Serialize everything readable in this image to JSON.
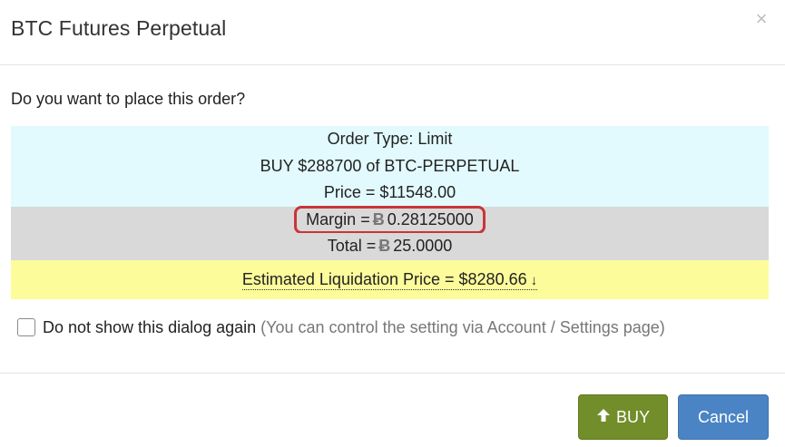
{
  "dialog": {
    "title": "BTC Futures Perpetual",
    "close_glyph": "×",
    "question": "Do you want to place this order?"
  },
  "summary": {
    "order_type": "Order Type: Limit",
    "order_desc": "BUY $288700 of BTC-PERPETUAL",
    "price": "Price = $11548.00",
    "margin_label": "Margin =",
    "margin_value": "0.28125000",
    "total_label": "Total =",
    "total_value": "25.0000",
    "btc_symbol": "Ƀ",
    "liquidation": "Estimated Liquidation Price = $8280.66",
    "liquidation_arrow": "↓"
  },
  "checkbox": {
    "checked": false,
    "label": "Do not show this dialog again",
    "hint": "(You can control the setting via Account / Settings page)"
  },
  "buttons": {
    "buy_label": "BUY",
    "buy_icon": "arrow-up-icon",
    "buy_glyph": "🡅",
    "cancel_label": "Cancel"
  },
  "colors": {
    "cyan_bg": "#e2fafd",
    "gray_bg": "#d9d9d9",
    "yellow_bg": "#fdfc9b",
    "highlight_border": "#c9353a",
    "buy_green": "#728e2a",
    "cancel_blue": "#4a84c4"
  }
}
